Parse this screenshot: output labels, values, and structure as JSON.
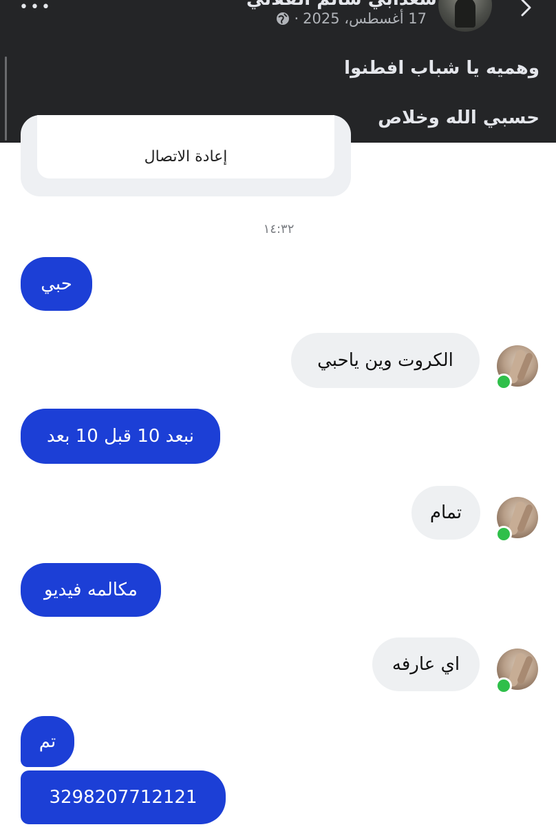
{
  "header": {
    "author": "سعدابي سالم الفلالي",
    "date": "17 أغسطس، 2025",
    "separator": "·",
    "more_label": "•••",
    "privacy_icon": "globe-icon",
    "back_icon": "chevron-right-icon",
    "post_lines": [
      "وهميه يا شباب افطنوا",
      "حسبي الله وخلاص"
    ]
  },
  "chat": {
    "call_card_button": "إعادة الاتصال",
    "timestamp": "١٤:٣٢",
    "messages": [
      {
        "side": "sent",
        "text": "حبي"
      },
      {
        "side": "received",
        "text": "الكروت وين ياحبي"
      },
      {
        "side": "sent",
        "text": "نبعد 10 قبل 10 بعد"
      },
      {
        "side": "received",
        "text": "تمام"
      },
      {
        "side": "sent",
        "text": "مكالمه فيديو"
      },
      {
        "side": "received",
        "text": "اي عارفه"
      },
      {
        "side": "sent",
        "text": "تم"
      },
      {
        "side": "sent",
        "text": "3298207712121"
      }
    ]
  },
  "colors": {
    "header_bg": "#242527",
    "sent_bubble": "#1c3fd6",
    "received_bubble": "#eef0f2",
    "online_dot": "#2fbf4a"
  }
}
